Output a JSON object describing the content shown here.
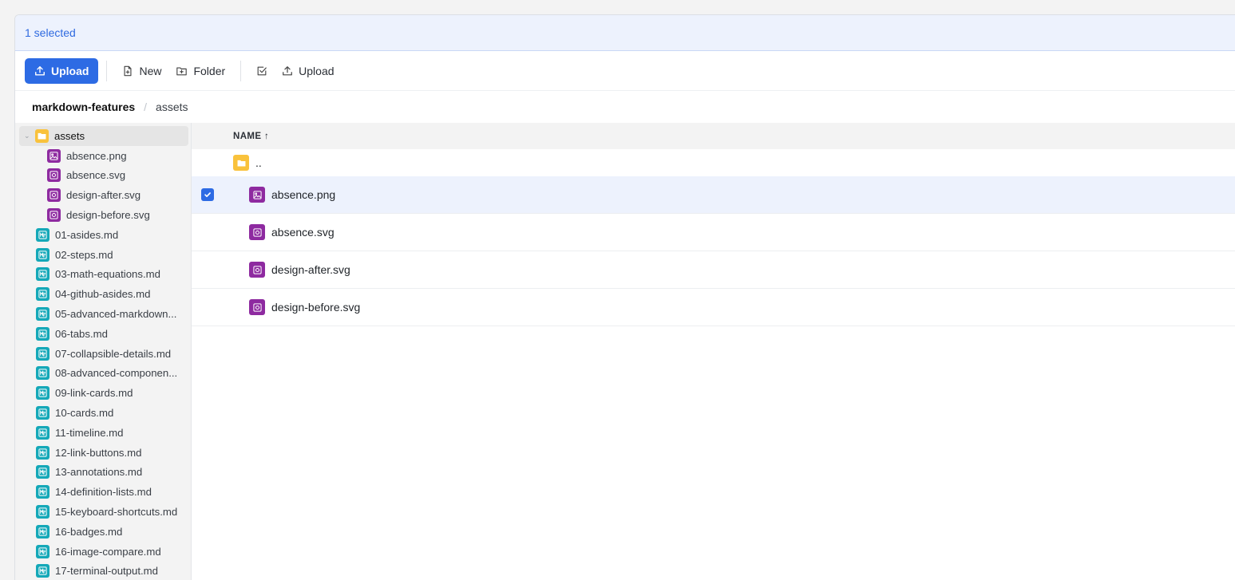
{
  "selection": {
    "text": "1 selected"
  },
  "toolbar": {
    "upload_primary": "Upload",
    "new_label": "New",
    "folder_label": "Folder",
    "upload_secondary": "Upload"
  },
  "breadcrumb": {
    "root": "markdown-features",
    "separator": "/",
    "current": "assets"
  },
  "sidebar": {
    "folder": {
      "label": "assets",
      "icon": "folder-icon"
    },
    "children": [
      {
        "label": "absence.png",
        "icon": "image-file-icon"
      },
      {
        "label": "absence.svg",
        "icon": "svg-file-icon"
      },
      {
        "label": "design-after.svg",
        "icon": "svg-file-icon"
      },
      {
        "label": "design-before.svg",
        "icon": "svg-file-icon"
      }
    ],
    "files": [
      {
        "label": "01-asides.md"
      },
      {
        "label": "02-steps.md"
      },
      {
        "label": "03-math-equations.md"
      },
      {
        "label": "04-github-asides.md"
      },
      {
        "label": "05-advanced-markdown..."
      },
      {
        "label": "06-tabs.md"
      },
      {
        "label": "07-collapsible-details.md"
      },
      {
        "label": "08-advanced-componen..."
      },
      {
        "label": "09-link-cards.md"
      },
      {
        "label": "10-cards.md"
      },
      {
        "label": "11-timeline.md"
      },
      {
        "label": "12-link-buttons.md"
      },
      {
        "label": "13-annotations.md"
      },
      {
        "label": "14-definition-lists.md"
      },
      {
        "label": "15-keyboard-shortcuts.md"
      },
      {
        "label": "16-badges.md"
      },
      {
        "label": "16-image-compare.md"
      },
      {
        "label": "17-terminal-output.md"
      }
    ]
  },
  "table": {
    "header_name": "NAME ↑",
    "parent_label": "..",
    "rows": [
      {
        "name": "absence.png",
        "selected": true,
        "icon": "image-file-icon"
      },
      {
        "name": "absence.svg",
        "selected": false,
        "icon": "svg-file-icon"
      },
      {
        "name": "design-after.svg",
        "selected": false,
        "icon": "svg-file-icon"
      },
      {
        "name": "design-before.svg",
        "selected": false,
        "icon": "svg-file-icon"
      }
    ]
  },
  "colors": {
    "accent": "#2d6be4",
    "folder": "#f9c23c",
    "image_file": "#8e2aa0",
    "markdown_file": "#14a8b8",
    "selection_bg": "#edf2fd"
  }
}
